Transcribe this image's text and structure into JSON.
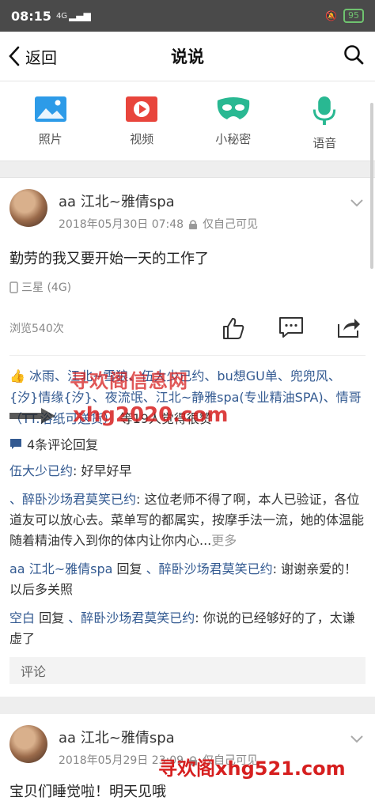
{
  "status_bar": {
    "time": "08:15",
    "signal": "4G",
    "battery": "95"
  },
  "nav": {
    "back_label": "返回",
    "title": "说说"
  },
  "actions": [
    {
      "label": "照片",
      "icon": "photo-icon",
      "color": "#2d9be8"
    },
    {
      "label": "视频",
      "icon": "video-icon",
      "color": "#e8453c"
    },
    {
      "label": "小秘密",
      "icon": "mask-icon",
      "color": "#29b892"
    },
    {
      "label": "语音",
      "icon": "microphone-icon",
      "color": "#29b892"
    }
  ],
  "post1": {
    "author": "aa 江北~雅倩spa",
    "date": "2018年05月30日 07:48",
    "privacy": "仅自己可见",
    "content": "勤劳的我又要开始一天的工作了",
    "device": "三星 (4G)",
    "views": "浏览540次",
    "likes_names": "冰雨、江北~雪狼、伍大少已约、bu想GU单、兜兜风、{汐}情缘{汐}、夜流氓、江北~静雅spa(专业精油SPA)、情哥（TT.浴纸可送货）",
    "likes_suffix": "等19人觉得很赞",
    "comment_count": "4条评论回复",
    "comments": [
      {
        "name": "伍大少已约",
        "text": ": 好早好早"
      },
      {
        "name": "、醉卧沙场君莫笑已约",
        "text": ": 这位老师不得了啊，本人已验证，各位道友可以放心去。菜单写的都属实，按摩手法一流，她的体温能随着精油传入到你的体内让你内心...",
        "more": "更多"
      },
      {
        "name": "aa 江北~雅倩spa",
        "mid": " 回复 ",
        "target": "、醉卧沙场君莫笑已约",
        "text": ": 谢谢亲爱的！以后多关照"
      },
      {
        "name": "空白",
        "mid": " 回复 ",
        "target": "、醉卧沙场君莫笑已约",
        "text": ": 你说的已经够好的了，太谦虚了"
      }
    ],
    "comment_placeholder": "评论"
  },
  "post2": {
    "author": "aa 江北~雅倩spa",
    "date": "2018年05月29日 23:09",
    "privacy": "仅自己可见",
    "content": "宝贝们睡觉啦！明天见哦"
  },
  "watermarks": {
    "line1": "寻欢阁信息网",
    "line2": "xhg2020.com",
    "line3": "寻欢阁xhg521.com"
  }
}
